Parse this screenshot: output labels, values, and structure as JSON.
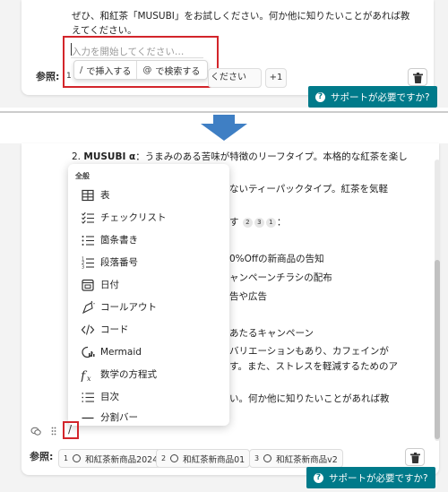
{
  "top": {
    "message_line1": "ぜひ、和紅茶「MUSUBI」をお試しください。何か他に知りたいことがあれば教",
    "message_line2": "えてください。",
    "input_placeholder": "入力を開始してください…",
    "popup": {
      "insert_key": "/",
      "insert_label": "で挿入する",
      "search_key": "@",
      "search_label": "で検索する"
    },
    "references_label": "参照:",
    "ref_first_num": "1",
    "ref_chip_text": "ください",
    "ref_more": "+1"
  },
  "help_button": "サポートが必要ですか?",
  "bottom": {
    "list_item_num": "2.",
    "list_item_bold": "MUSUBI α",
    "list_item_rest": "：うまみのある苦味が特徴のリーフタイプ。本格的な紅茶を楽し",
    "behind_lines": [
      "ないティーパックタイプ。紅茶を気軽",
      "す",
      "0%Offの新商品の告知",
      "ャンペーンチラシの配布",
      "告や広告",
      "あたるキャンペーン",
      "バリエーションもあり、カフェインが",
      "す。また、ストレスを軽減するためのア",
      "い。何か他に知りたいことがあれば教"
    ],
    "behind_circles": [
      "2",
      "3",
      "1"
    ],
    "behind_colon": "：",
    "slash_char": "/",
    "menu": {
      "header": "全般",
      "items": [
        {
          "label": "表",
          "icon": "table-icon"
        },
        {
          "label": "チェックリスト",
          "icon": "checklist-icon"
        },
        {
          "label": "箇条書き",
          "icon": "bullet-list-icon"
        },
        {
          "label": "段落番号",
          "icon": "numbered-list-icon"
        },
        {
          "label": "日付",
          "icon": "calendar-icon"
        },
        {
          "label": "コールアウト",
          "icon": "callout-icon"
        },
        {
          "label": "コード",
          "icon": "code-icon"
        },
        {
          "label": "Mermaid",
          "icon": "mermaid-icon"
        },
        {
          "label": "数学の方程式",
          "icon": "math-icon"
        },
        {
          "label": "目次",
          "icon": "toc-icon"
        },
        {
          "label": "分割バー",
          "icon": "divider-icon"
        }
      ]
    },
    "references_label": "参照:",
    "refs": [
      {
        "num": "1",
        "label": "和紅茶新商品2024"
      },
      {
        "num": "2",
        "label": "和紅茶新商品01"
      },
      {
        "num": "3",
        "label": "和紅茶新商品v2"
      }
    ]
  },
  "colors": {
    "accent": "#007a8a",
    "highlight": "#d3252b",
    "arrow": "#3f7fc4"
  }
}
